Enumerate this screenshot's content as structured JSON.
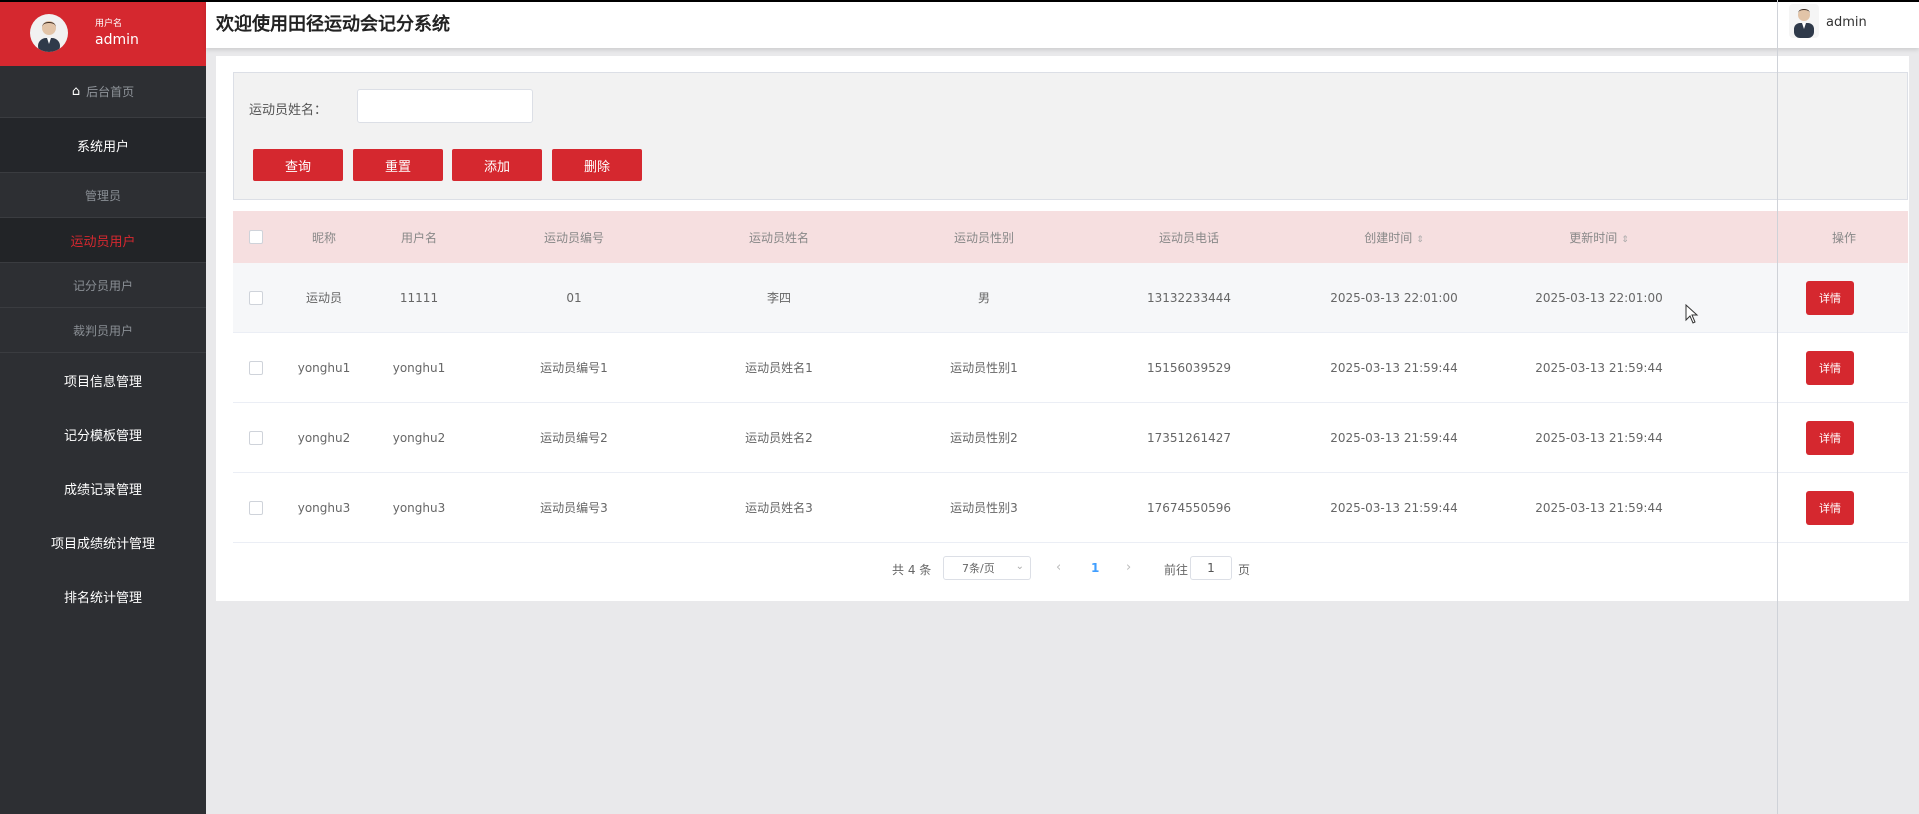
{
  "sidebar": {
    "user_role": "用户名",
    "user_name": "admin",
    "home": "后台首页",
    "group_system_users": "系统用户",
    "items": [
      "管理员",
      "运动员用户",
      "记分员用户",
      "裁判员用户"
    ],
    "main_items": [
      "项目信息管理",
      "记分模板管理",
      "成绩记录管理",
      "项目成绩统计管理",
      "排名统计管理"
    ]
  },
  "header": {
    "title": "欢迎使用田径运动会记分系统",
    "user": "admin"
  },
  "search": {
    "label": "运动员姓名：",
    "input_value": "",
    "buttons": [
      "查询",
      "重置",
      "添加",
      "删除"
    ]
  },
  "table": {
    "headers": [
      "昵称",
      "用户名",
      "运动员编号",
      "运动员姓名",
      "运动员性别",
      "运动员电话",
      "创建时间",
      "更新时间",
      "操作"
    ],
    "rows": [
      [
        "运动员",
        "11111",
        "01",
        "李四",
        "男",
        "13132233444",
        "2025-03-13 22:01:00",
        "2025-03-13 22:01:00"
      ],
      [
        "yonghu1",
        "yonghu1",
        "运动员编号1",
        "运动员姓名1",
        "运动员性别1",
        "15156039529",
        "2025-03-13 21:59:44",
        "2025-03-13 21:59:44"
      ],
      [
        "yonghu2",
        "yonghu2",
        "运动员编号2",
        "运动员姓名2",
        "运动员性别2",
        "17351261427",
        "2025-03-13 21:59:44",
        "2025-03-13 21:59:44"
      ],
      [
        "yonghu3",
        "yonghu3",
        "运动员编号3",
        "运动员姓名3",
        "运动员性别3",
        "17674550596",
        "2025-03-13 21:59:44",
        "2025-03-13 21:59:44"
      ]
    ],
    "detail_label": "详情"
  },
  "pagination": {
    "total": "共 4 条",
    "page_size": "7条/页",
    "current_page": "1",
    "goto_label": "前往",
    "goto_value": "1",
    "goto_unit": "页"
  },
  "colors": {
    "accent": "#d5282f",
    "sidebar_bg": "#2d2f33",
    "header_row_bg": "#f6dfe0",
    "link_blue": "#409eff"
  }
}
